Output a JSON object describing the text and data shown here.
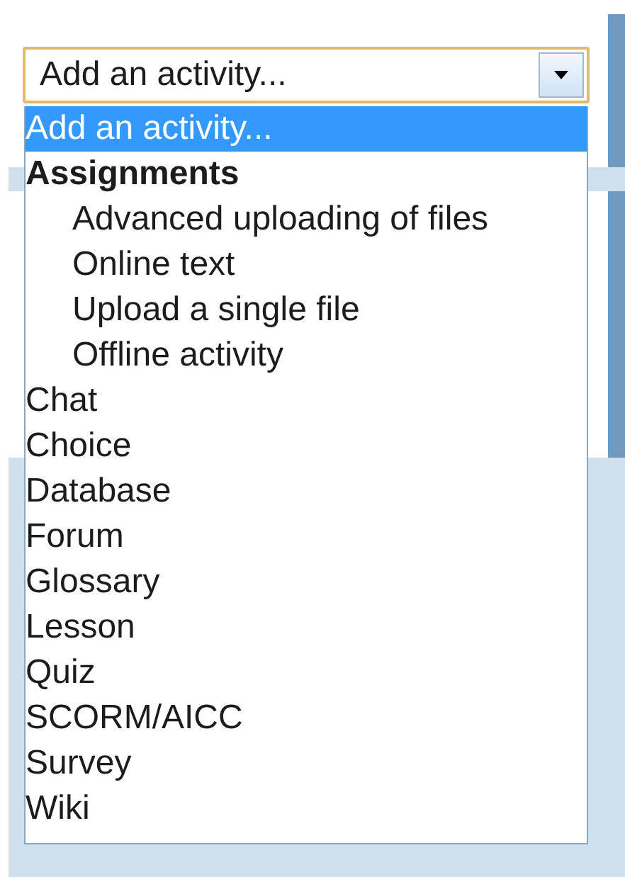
{
  "select": {
    "value": "Add an activity...",
    "expanded": true
  },
  "options": [
    {
      "kind": "option",
      "label": "Add an activity...",
      "selected": true
    },
    {
      "kind": "group",
      "label": "Assignments",
      "selected": false,
      "children": [
        {
          "kind": "option",
          "label": "Advanced uploading of files",
          "selected": false
        },
        {
          "kind": "option",
          "label": "Online text",
          "selected": false
        },
        {
          "kind": "option",
          "label": "Upload a single file",
          "selected": false
        },
        {
          "kind": "option",
          "label": "Offline activity",
          "selected": false
        }
      ]
    },
    {
      "kind": "option",
      "label": "Chat",
      "selected": false
    },
    {
      "kind": "option",
      "label": "Choice",
      "selected": false
    },
    {
      "kind": "option",
      "label": "Database",
      "selected": false
    },
    {
      "kind": "option",
      "label": "Forum",
      "selected": false
    },
    {
      "kind": "option",
      "label": "Glossary",
      "selected": false
    },
    {
      "kind": "option",
      "label": "Lesson",
      "selected": false
    },
    {
      "kind": "option",
      "label": "Quiz",
      "selected": false
    },
    {
      "kind": "option",
      "label": "SCORM/AICC",
      "selected": false
    },
    {
      "kind": "option",
      "label": "Survey",
      "selected": false
    },
    {
      "kind": "option",
      "label": "Wiki",
      "selected": false
    }
  ]
}
